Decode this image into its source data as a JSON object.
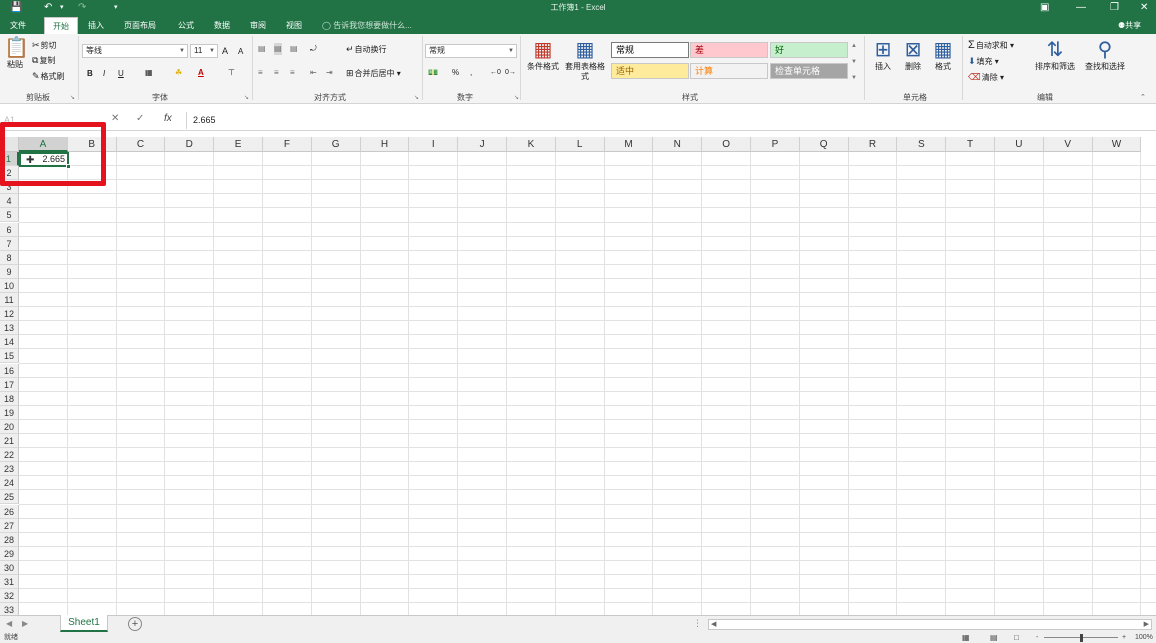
{
  "window": {
    "title": "工作簿1 - Excel",
    "save_icon": "save-icon",
    "undo_icon": "undo-icon",
    "redo_icon": "redo-icon",
    "customize_icon": "customize-qat-icon",
    "ribbon_display_icon": "ribbon-display-icon",
    "minimize_icon": "minimize-icon",
    "restore_icon": "restore-icon",
    "close_icon": "close-icon"
  },
  "tabs": [
    "文件",
    "开始",
    "插入",
    "页面布局",
    "公式",
    "数据",
    "审阅",
    "视图"
  ],
  "active_tab": "开始",
  "tell_me": "告诉我您想要做什么...",
  "share": "共享",
  "ribbon": {
    "clipboard": {
      "paste": "粘贴",
      "cut": "剪切",
      "copy": "复制",
      "format_painter": "格式刷",
      "label": "剪贴板"
    },
    "font": {
      "name": "等线",
      "size": "11",
      "grow": "A",
      "shrink": "A",
      "bold": "B",
      "italic": "I",
      "underline": "U",
      "font_color_letter": "A",
      "label": "字体"
    },
    "alignment": {
      "wrap": "自动换行",
      "merge": "合并后居中",
      "label": "对齐方式"
    },
    "number": {
      "format": "常规",
      "percent": "%",
      "comma": ",",
      "label": "数字"
    },
    "styles": {
      "conditional": "条件格式",
      "table": "套用表格格式",
      "cells": [
        {
          "text": "常规",
          "bg": "#ffffff",
          "fg": "#000000"
        },
        {
          "text": "差",
          "bg": "#ffc7ce",
          "fg": "#9c0006"
        },
        {
          "text": "好",
          "bg": "#c6efce",
          "fg": "#006100"
        },
        {
          "text": "适中",
          "bg": "#ffeb9c",
          "fg": "#9c6500"
        },
        {
          "text": "计算",
          "bg": "#f2f2f2",
          "fg": "#fa7d00"
        },
        {
          "text": "检查单元格",
          "bg": "#a5a5a5",
          "fg": "#ffffff"
        }
      ],
      "label": "样式"
    },
    "cells_group": {
      "insert": "插入",
      "delete": "删除",
      "format": "格式",
      "label": "单元格"
    },
    "editing": {
      "autosum": "自动求和",
      "fill": "填充",
      "clear": "清除",
      "sort": "排序和筛选",
      "find": "查找和选择",
      "label": "编辑"
    }
  },
  "formula_bar": {
    "name_box": "A1",
    "cancel": "✕",
    "enter": "✓",
    "fx": "fx",
    "content": "2.665"
  },
  "columns": [
    "A",
    "B",
    "C",
    "D",
    "E",
    "F",
    "G",
    "H",
    "I",
    "J",
    "K",
    "L",
    "M",
    "N",
    "O",
    "P",
    "Q",
    "R",
    "S",
    "T",
    "U",
    "V",
    "W"
  ],
  "rows": [
    "1",
    "2",
    "3",
    "4",
    "5",
    "6",
    "7",
    "8",
    "9",
    "10",
    "11",
    "12",
    "13",
    "14",
    "15",
    "16",
    "17",
    "18",
    "19",
    "20",
    "21",
    "22",
    "23",
    "24",
    "25",
    "26",
    "27",
    "28",
    "29",
    "30",
    "31",
    "32",
    "33"
  ],
  "selected_column": "A",
  "selected_row": "1",
  "cell_a1": "2.665",
  "sheets": [
    "Sheet1"
  ],
  "status": {
    "ready": "就绪",
    "zoom": "100%",
    "zoom_minus": "-",
    "zoom_plus": "+"
  },
  "colors": {
    "accent": "#217346",
    "highlight": "#e5131d"
  }
}
